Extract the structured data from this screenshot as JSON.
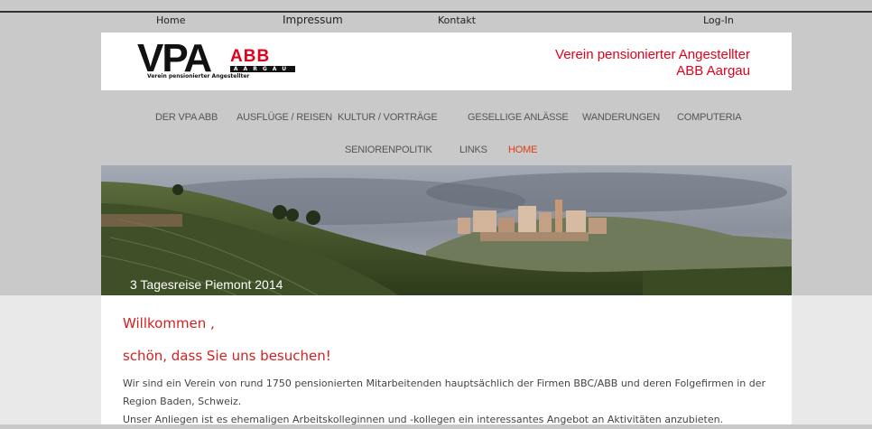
{
  "topnav": {
    "home": "Home",
    "impressum": "Impressum",
    "kontakt": "Kontakt",
    "login": "Log-In"
  },
  "header": {
    "logo_vpa": "VPA",
    "logo_abb": "ABB",
    "logo_aargau": "AARGAU",
    "logo_sub": "Verein pensionierter Angestellter",
    "org_line1": "Verein pensionierter Angestellter",
    "org_line2": "ABB Aargau"
  },
  "mainnav": {
    "items": [
      "DER VPA ABB",
      "AUSFLÜGE / REISEN",
      "KULTUR / VORTRÄGE",
      "GESELLIGE ANLÄSSE",
      "WANDERUNGEN",
      "COMPUTERIA",
      "SENIORENPOLITIK",
      "LINKS",
      "HOME"
    ],
    "active": "HOME"
  },
  "banner": {
    "caption": "3 Tagesreise Piemont 2014"
  },
  "content": {
    "title1": "Willkommen ,",
    "title2": "schön, dass Sie uns besuchen!",
    "para1_line1": "Wir sind ein Verein von rund 1750 pensionierten Mitarbeitenden hauptsächlich der Firmen BBC/ABB und deren Folgefirmen in der",
    "para1_line2": "Region Baden, Schweiz.",
    "para2_line1": "Unser Anliegen ist es ehemaligen Arbeitskolleginnen und -kollegen ein interessantes Angebot an Aktivitäten anzubieten."
  },
  "colors": {
    "accent": "#e3001b",
    "nav_active": "#e33b12",
    "title": "#d41f1f",
    "background": "#c9c9c9"
  }
}
